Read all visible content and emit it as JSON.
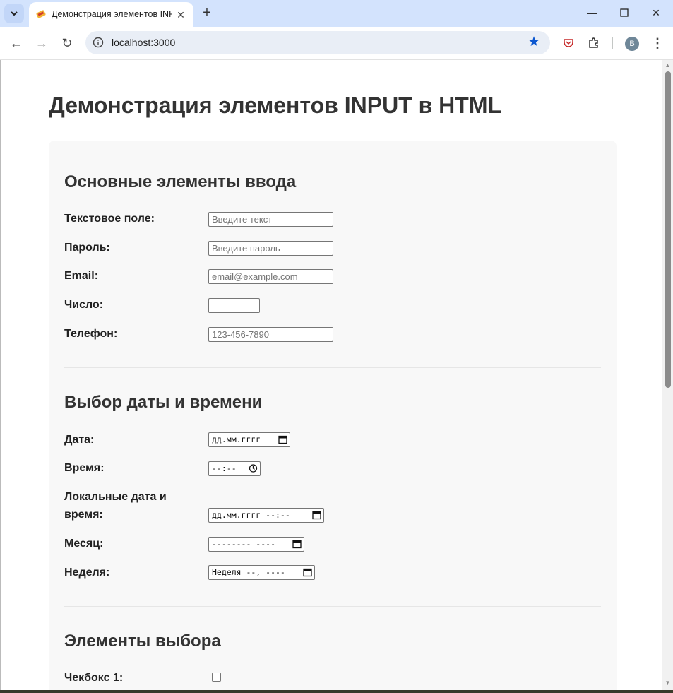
{
  "browser": {
    "tab_title": "Демонстрация элементов INPUT в HTML",
    "url": "localhost:3000",
    "profile_initial": "B"
  },
  "page": {
    "title": "Демонстрация элементов INPUT в HTML",
    "sections": {
      "basic": {
        "title": "Основные элементы ввода",
        "text_label": "Текстовое поле:",
        "text_placeholder": "Введите текст",
        "password_label": "Пароль:",
        "password_placeholder": "Введите пароль",
        "email_label": "Email:",
        "email_placeholder": "email@example.com",
        "number_label": "Число:",
        "number_value": "",
        "phone_label": "Телефон:",
        "phone_placeholder": "123-456-7890"
      },
      "datetime": {
        "title": "Выбор даты и времени",
        "date_label": "Дата:",
        "date_value": "дд.мм.гггг",
        "time_label": "Время:",
        "time_value": "--:--",
        "datetime_label": "Локальные дата и время:",
        "datetime_value": "дд.мм.гггг --:--",
        "month_label": "Месяц:",
        "month_value": "-------- ----",
        "week_label": "Неделя:",
        "week_value": "Неделя --, ----"
      },
      "choice": {
        "title": "Элементы выбора",
        "checkbox1_label": "Чекбокс 1:",
        "checkbox1_checked": false
      }
    }
  }
}
